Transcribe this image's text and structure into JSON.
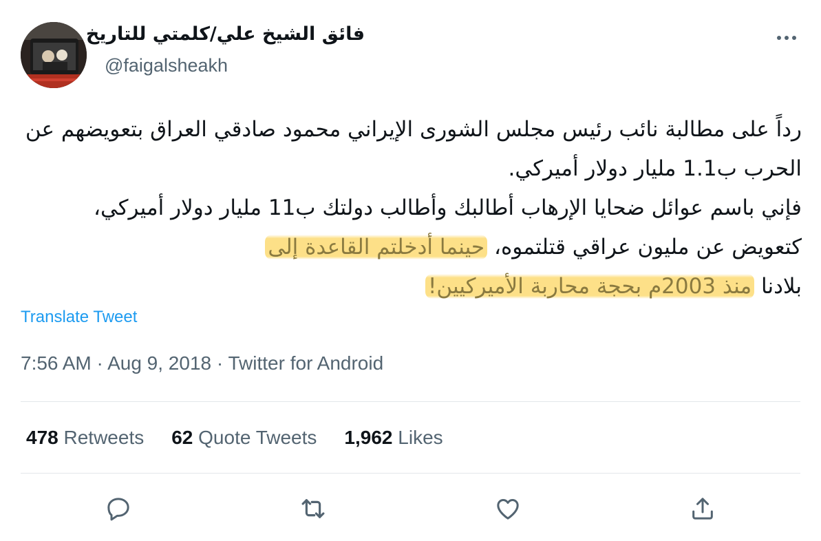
{
  "tweet": {
    "display_name": "فائق الشيخ علي/كلمتي للتاريخ",
    "handle": "@faigalsheakh",
    "paragraph1": "رداً على مطالبة نائب رئيس مجلس الشورى الإيراني محمود صادقي العراق بتعويضهم عن الحرب ب1.1 مليار دولار أميركي.",
    "paragraph2_plain": "فإني باسم عوائل ضحايا الإرهاب أطالبك وأطالب دولتك ب11 مليار دولار أميركي، كتعويض عن مليون عراقي قتلتموه، ",
    "paragraph2_highlight_a": "حينما أدخلتم القاعدة إلى",
    "paragraph2_after_break": "بلادنا ",
    "paragraph2_highlight_b": "منذ 2003م بحجة محاربة الأميركيين!",
    "translate_label": "Translate Tweet",
    "time": "7:56 AM",
    "date": "Aug 9, 2018",
    "source": "Twitter for Android",
    "separator": "·"
  },
  "stats": {
    "retweets_count": "478",
    "retweets_label": "Retweets",
    "quotes_count": "62",
    "quotes_label": "Quote Tweets",
    "likes_count": "1,962",
    "likes_label": "Likes"
  },
  "icons": {
    "reply": "reply-icon",
    "retweet": "retweet-icon",
    "like": "heart-icon",
    "share": "share-icon",
    "more": "more-icon"
  },
  "colors": {
    "text": "#0f1419",
    "secondary": "#536471",
    "link": "#1d9bf0",
    "highlight": "#fcd660"
  }
}
